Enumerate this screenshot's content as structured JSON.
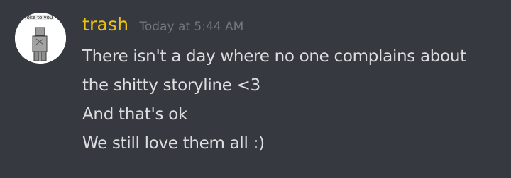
{
  "message": {
    "author": "trash",
    "author_color": "#f1c40f",
    "timestamp": "Today at 5:44 AM",
    "avatar_caption": "i a joke to you",
    "lines": [
      "There isn't a day where no one complains about",
      "the shitty storyline <3",
      "And that's ok",
      "We still love them all :)"
    ]
  },
  "colors": {
    "background": "#36393f",
    "text": "#dcddde",
    "timestamp": "#72767d"
  }
}
